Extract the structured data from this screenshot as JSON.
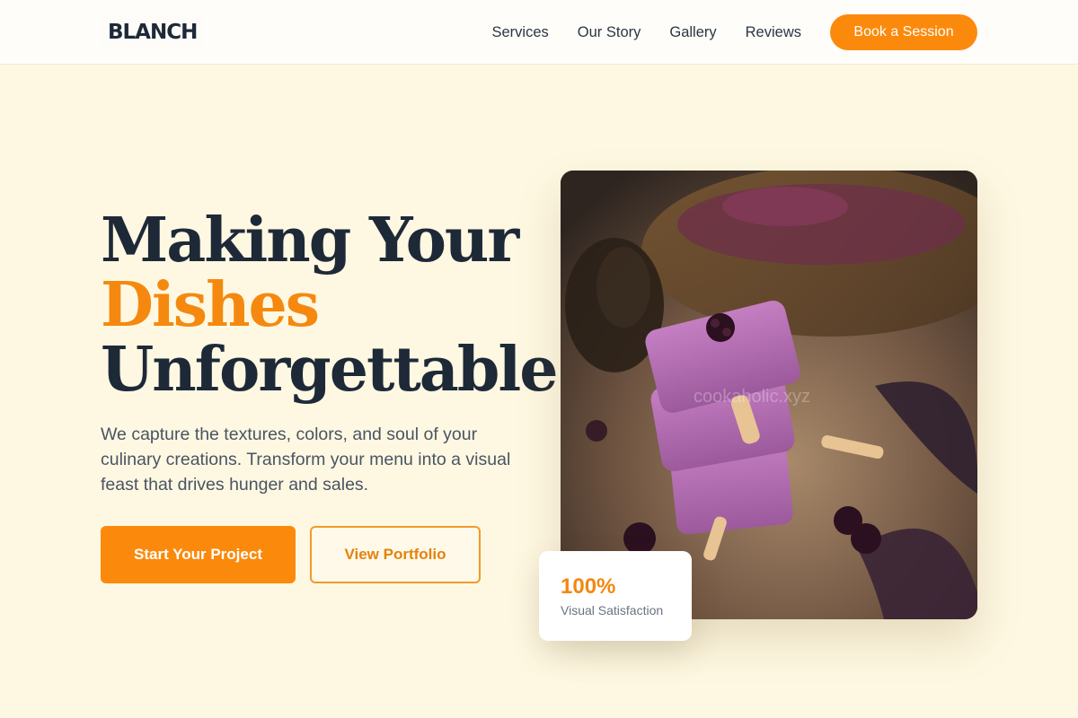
{
  "brand": {
    "logo": "BLANCH"
  },
  "nav": {
    "links": [
      "Services",
      "Our Story",
      "Gallery",
      "Reviews"
    ],
    "cta": "Book a Session"
  },
  "hero": {
    "title_line1": "Making Your",
    "title_accent": "Dishes",
    "title_line3": "Unforgettable.",
    "description": "We capture the textures, colors, and soul of your culinary creations. Transform your menu into a visual feast that drives hunger and sales.",
    "primary_cta": "Start Your Project",
    "secondary_cta": "View Portfolio",
    "image_watermark": "cookaholic.xyz"
  },
  "stat": {
    "value": "100%",
    "label": "Visual Satisfaction"
  },
  "colors": {
    "accent": "#fb8a0c",
    "background": "#fef8e2",
    "heading": "#1e2938",
    "body_text": "#4a5462"
  },
  "icons": {
    "image": "berry-popsicle-photo"
  }
}
